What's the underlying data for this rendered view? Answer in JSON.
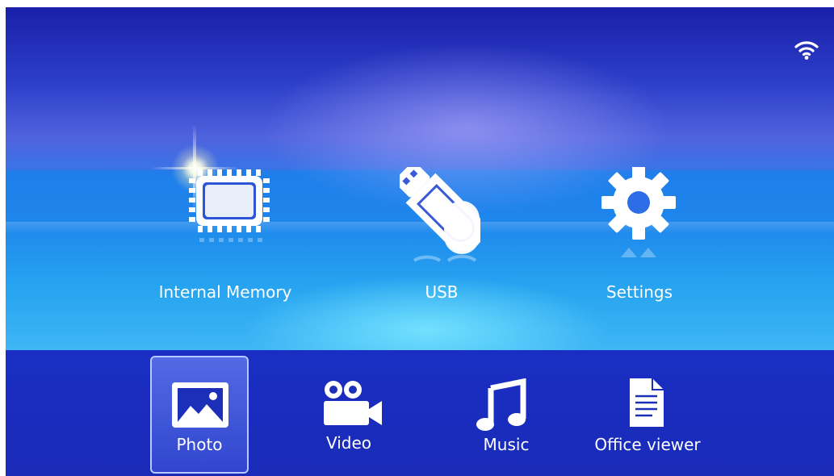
{
  "status_bar": {
    "wifi_icon": "wifi-icon"
  },
  "main_menu": [
    {
      "label": "Internal Memory",
      "icon": "memory-chip-icon"
    },
    {
      "label": "USB",
      "icon": "usb-drive-icon"
    },
    {
      "label": "Settings",
      "icon": "gear-icon"
    }
  ],
  "media_bar": [
    {
      "label": "Photo",
      "icon": "photo-icon",
      "selected": true
    },
    {
      "label": "Video",
      "icon": "video-camera-icon",
      "selected": false
    },
    {
      "label": "Music",
      "icon": "music-note-icon",
      "selected": false
    },
    {
      "label": "Office viewer",
      "icon": "document-icon",
      "selected": false
    }
  ],
  "colors": {
    "top_bg": "#1a1fa8",
    "bottom_bg": "#1a2ec4",
    "highlight": "#b8c8ff",
    "text": "#ffffff"
  }
}
